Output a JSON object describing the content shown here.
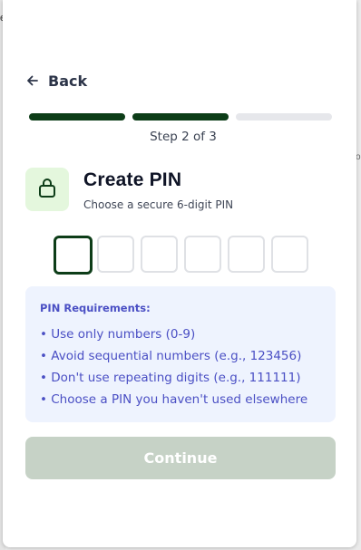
{
  "background": {
    "left_fragment": "e",
    "right_fragment": "o"
  },
  "nav": {
    "back_label": "Back",
    "back_icon": "arrow-left-icon"
  },
  "progress": {
    "current_step": 2,
    "total_steps": 3,
    "step_text": "Step 2 of 3",
    "complete_color": "#0d3d18",
    "incomplete_color": "#e6e7eb"
  },
  "header": {
    "icon": "lock-icon",
    "title": "Create PIN",
    "subtitle": "Choose a secure 6-digit PIN"
  },
  "pin": {
    "length": 6,
    "active_index": 0,
    "values": [
      "",
      "",
      "",
      "",
      "",
      ""
    ]
  },
  "requirements": {
    "title": "PIN Requirements:",
    "items": [
      "• Use only numbers (0-9)",
      "• Avoid sequential numbers (e.g., 123456)",
      "• Don't use repeating digits (e.g., 111111)",
      "• Choose a PIN you haven't used elsewhere"
    ]
  },
  "actions": {
    "continue_label": "Continue",
    "continue_enabled": false
  },
  "colors": {
    "accent": "#0d3d18",
    "lock_bg": "#e4f7dd",
    "requirements_bg": "#eef3fe",
    "requirements_text": "#4a4fc4",
    "button_disabled": "#c6d2c6"
  }
}
